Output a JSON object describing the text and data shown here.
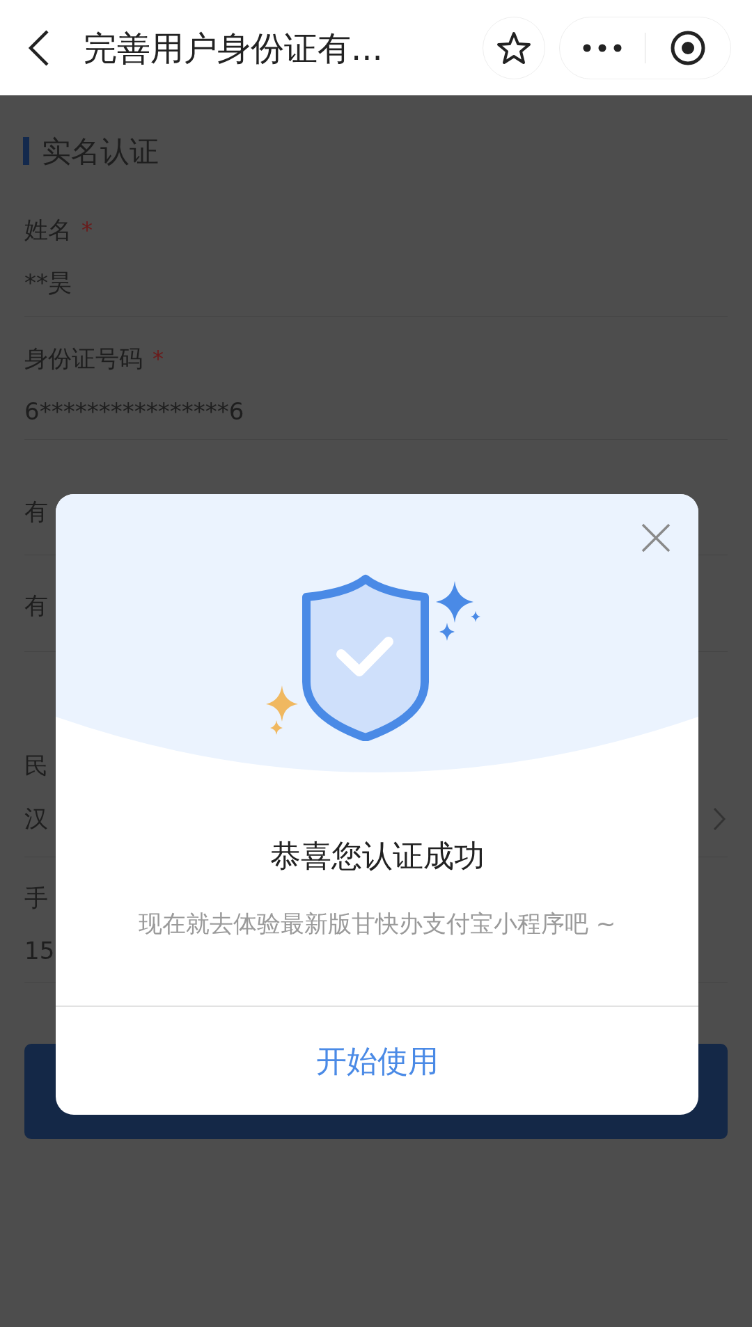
{
  "header": {
    "title": "完善用户身份证有..."
  },
  "section": {
    "title": "实名认证"
  },
  "fields": [
    {
      "kind": "double",
      "label": "姓名",
      "mark": "*",
      "value": "**昊"
    },
    {
      "kind": "double",
      "label": "身份证号码",
      "mark": "*",
      "value": "6****************6"
    },
    {
      "kind": "single",
      "label": "有"
    },
    {
      "kind": "single",
      "label": "有"
    },
    {
      "kind": "select",
      "label": "民",
      "value": "汉"
    },
    {
      "kind": "double",
      "label": "手",
      "value": "15"
    }
  ],
  "dialog": {
    "title": "恭喜您认证成功",
    "message": "现在就去体验最新版甘快办支付宝小程序吧 ~",
    "button": "开始使用"
  }
}
